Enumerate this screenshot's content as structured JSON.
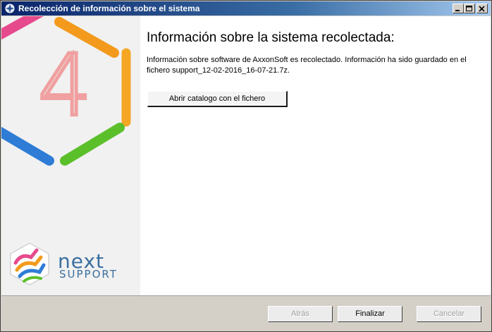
{
  "window": {
    "title": "Recolección de información sobre el sistema"
  },
  "sidebar": {
    "brand_next": "next",
    "brand_support": "SUPPORT",
    "big_digit": "4"
  },
  "main": {
    "heading": "Información sobre la sistema recolectada:",
    "description": "Información sobre software de AxxonSoft es recolectado. Información ha sido guardado en el fichero support_12-02-2016_16-07-21.7z.",
    "open_folder_label": "Abrir catalogo con el fichero"
  },
  "footer": {
    "back_label": "Atrás",
    "finish_label": "Finalizar",
    "cancel_label": "Cancelar"
  },
  "colors": {
    "titlebar_start": "#0a246a",
    "titlebar_end": "#a6caf0",
    "hex_orange": "#f39a1d",
    "hex_blue": "#2e7cd6",
    "hex_green": "#5bbf2a",
    "hex_pink": "#e64a8c",
    "digit": "#f0a0a0"
  }
}
